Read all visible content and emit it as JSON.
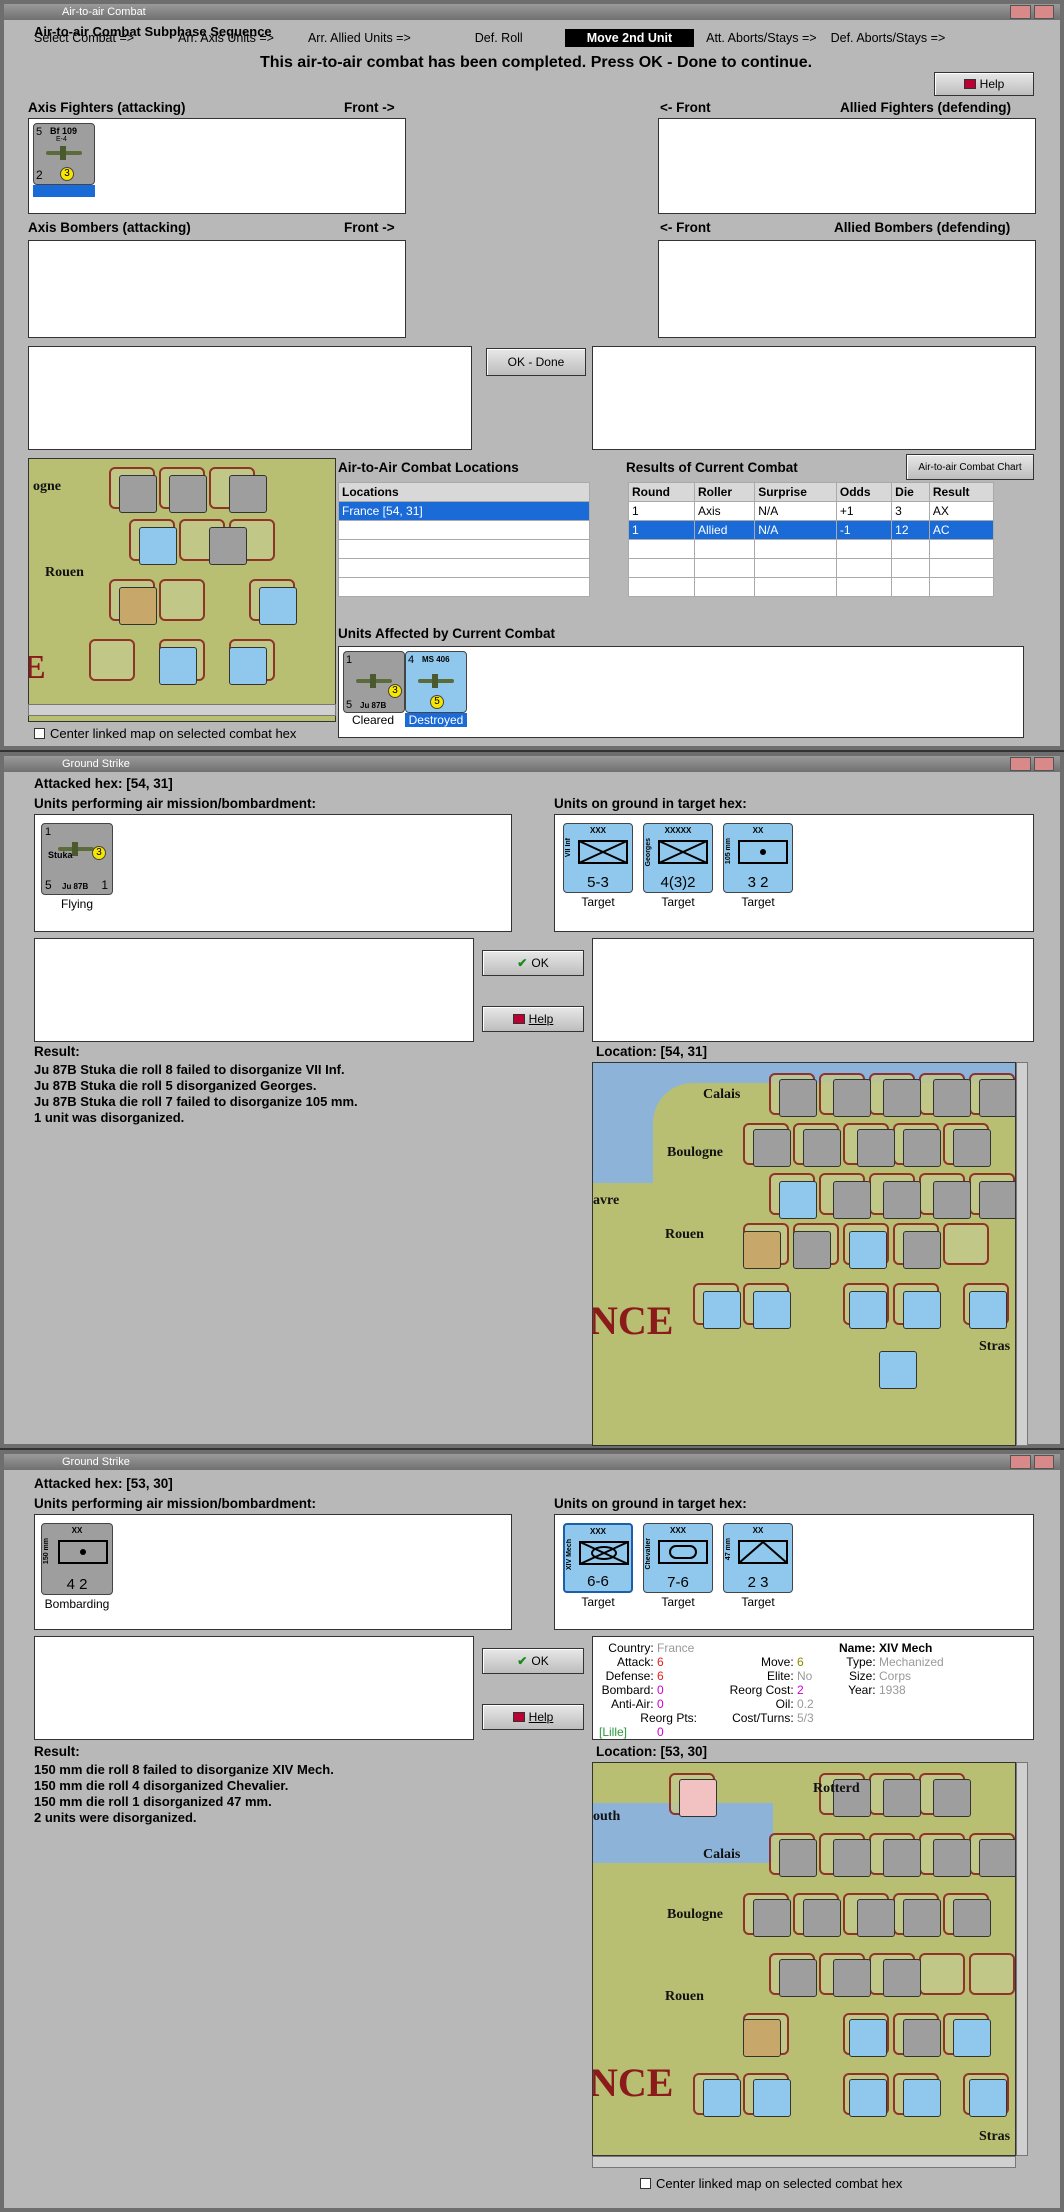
{
  "w1": {
    "title": "Air-to-air Combat",
    "heading": "Air-to-air Combat Subphase Sequence",
    "sequence": [
      "Select Combat =>",
      "Arr. Axis Units =>",
      "Arr. Allied Units =>",
      "Def. Roll",
      "Move 2nd Unit",
      "Att. Aborts/Stays =>",
      "Def. Aborts/Stays =>"
    ],
    "message": "This air-to-air combat has been completed.  Press OK - Done to continue.",
    "help": "Help",
    "axis_fighters": "Axis Fighters (attacking)",
    "front_r": "Front ->",
    "front_l": "<- Front",
    "allied_fighters": "Allied Fighters (defending)",
    "axis_bombers": "Axis Bombers (attacking)",
    "allied_bombers": "Allied Bombers (defending)",
    "ok_done": "OK - Done",
    "locations_title": "Air-to-Air Combat Locations",
    "locations_header": "Locations",
    "locations": [
      "France [54, 31]"
    ],
    "results_title": "Results of Current Combat",
    "chart_button": "Air-to-air Combat Chart",
    "results_headers": [
      "Round",
      "Roller",
      "Surprise",
      "Odds",
      "Die",
      "Result"
    ],
    "results": [
      [
        "1",
        "Axis",
        "N/A",
        "+1",
        "3",
        "AX"
      ],
      [
        "1",
        "Allied",
        "N/A",
        "-1",
        "12",
        "AC"
      ]
    ],
    "affected_title": "Units Affected by Current Combat",
    "affected": [
      {
        "name": "Ju 87B",
        "status": "Cleared",
        "top": "1",
        "stats": "5",
        "right": "3"
      },
      {
        "name": "MS 406",
        "status": "Destroyed",
        "top": "4",
        "stats": "",
        "right": "5"
      }
    ],
    "fighter_unit": {
      "name": "Bf 109",
      "sub": "E-4",
      "stats": "2",
      "top": "5",
      "right": "3"
    },
    "center_map": "Center linked map on selected combat hex"
  },
  "w2": {
    "title": "Ground Strike",
    "attacked": "Attacked hex:  [54, 31]",
    "performing": "Units performing air mission/bombardment:",
    "on_ground": "Units on ground in target hex:",
    "air_unit": {
      "name": "Ju 87B",
      "label": "Stuka",
      "top": "1",
      "stats": "5",
      "right": "1",
      "badge": "3",
      "caption": "Flying"
    },
    "targets": [
      {
        "name": "VII Inf",
        "size": "XXX",
        "stats": "5-3",
        "caption": "Target"
      },
      {
        "name": "Georges",
        "size": "XXXXX",
        "stats": "4(3)2",
        "caption": "Target"
      },
      {
        "name": "105 mm",
        "size": "XX",
        "stats": "3 2",
        "caption": "Target"
      }
    ],
    "ok": "OK",
    "help": "Help",
    "result_label": "Result:",
    "result_lines": [
      "Ju 87B Stuka die roll 8 failed to disorganize VII Inf.",
      "Ju 87B Stuka die roll 5 disorganized Georges.",
      "Ju 87B Stuka die roll 7 failed to disorganize 105 mm.",
      "1 unit was disorganized."
    ],
    "location": "Location:  [54, 31]",
    "map_labels": [
      "Calais",
      "Boulogne",
      "Rouen",
      "avre",
      "NCE",
      "Stras"
    ]
  },
  "w3": {
    "title": "Ground Strike",
    "attacked": "Attacked hex:  [53, 30]",
    "performing": "Units performing air mission/bombardment:",
    "on_ground": "Units on ground in target hex:",
    "air_unit": {
      "name": "150 mm",
      "size": "XX",
      "stats": "4 2",
      "caption": "Bombarding"
    },
    "targets": [
      {
        "name": "XIV Mech",
        "size": "XXX",
        "stats": "6-6",
        "caption": "Target"
      },
      {
        "name": "Chevalier",
        "size": "XXX",
        "stats": "7-6",
        "caption": "Target"
      },
      {
        "name": "47 mm",
        "size": "XX",
        "stats": "2 3",
        "caption": "Target"
      }
    ],
    "ok": "OK",
    "help": "Help",
    "info_left": [
      [
        "Country:",
        "France"
      ],
      [
        "Attack:",
        "6"
      ],
      [
        "Defense:",
        "6"
      ],
      [
        "Bombard:",
        "0"
      ],
      [
        "Anti-Air:",
        "0"
      ],
      [
        "Reorg Pts:",
        "0"
      ]
    ],
    "info_link": "[Lille]",
    "info_mid": [
      [
        "Move:",
        "6"
      ],
      [
        "Elite:",
        "No"
      ],
      [
        "Reorg Cost:",
        "2"
      ],
      [
        "Oil:",
        "0.2"
      ],
      [
        "Cost/Turns:",
        "5/3"
      ]
    ],
    "info_right": [
      [
        "Name:",
        "XIV Mech"
      ],
      [
        "Type:",
        "Mechanized"
      ],
      [
        "Size:",
        "Corps"
      ],
      [
        "Year:",
        "1938"
      ]
    ],
    "result_label": "Result:",
    "result_lines": [
      "150 mm die roll 8 failed to disorganize XIV Mech.",
      "150 mm die roll 4 disorganized Chevalier.",
      "150 mm die roll 1 disorganized 47 mm.",
      "2 units were disorganized."
    ],
    "location": "Location:  [53, 30]",
    "map_labels": [
      "Rotterd",
      "Calais",
      "Boulogne",
      "Rouen",
      "outh",
      "NCE",
      "Stras"
    ],
    "center_map": "Center linked map on selected combat hex"
  }
}
